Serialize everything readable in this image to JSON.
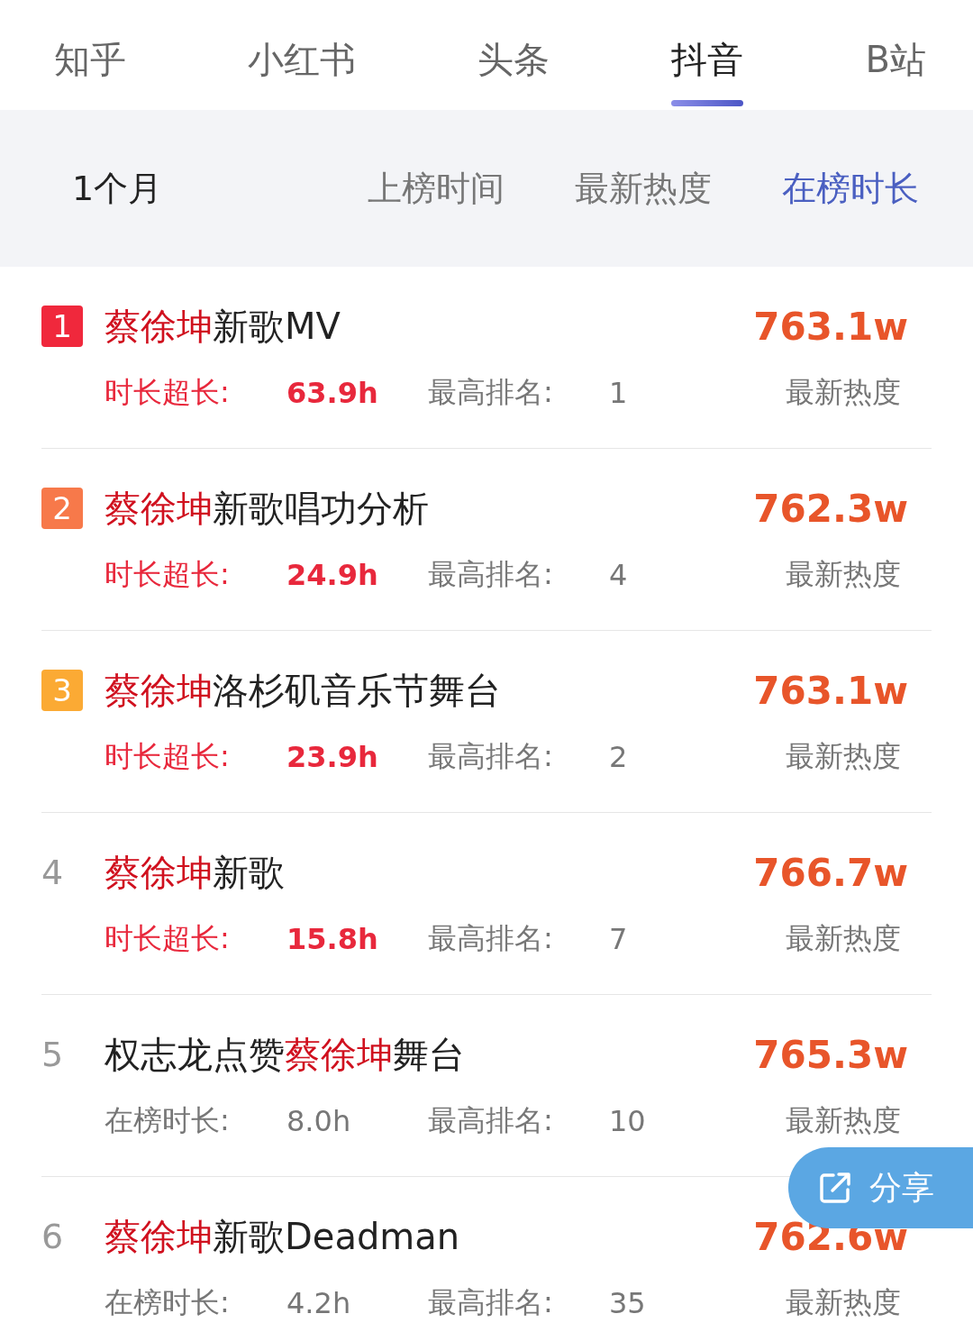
{
  "tabs": [
    {
      "label": "知乎",
      "selected": false
    },
    {
      "label": "小红书",
      "selected": false
    },
    {
      "label": "头条",
      "selected": false
    },
    {
      "label": "抖音",
      "selected": true
    },
    {
      "label": "B站",
      "selected": false
    }
  ],
  "filters": {
    "period": "1个月",
    "sorts": [
      {
        "label": "上榜时间",
        "selected": false
      },
      {
        "label": "最新热度",
        "selected": false
      },
      {
        "label": "在榜时长",
        "selected": true
      }
    ]
  },
  "items": [
    {
      "rank": "1",
      "kind": "badge",
      "color": "#f0283c",
      "title_parts": [
        {
          "text": "蔡徐坤",
          "highlight": true
        },
        {
          "text": "新歌MV",
          "highlight": false
        }
      ],
      "heat": "763.1w",
      "duration_highlighted": true,
      "duration_label": "时长超长:",
      "duration": "63.9h",
      "best_label": "最高排名:",
      "best": "1",
      "heat_label": "最新热度"
    },
    {
      "rank": "2",
      "kind": "badge",
      "color": "#f7794a",
      "title_parts": [
        {
          "text": "蔡徐坤",
          "highlight": true
        },
        {
          "text": "新歌唱功分析",
          "highlight": false
        }
      ],
      "heat": "762.3w",
      "duration_highlighted": true,
      "duration_label": "时长超长:",
      "duration": "24.9h",
      "best_label": "最高排名:",
      "best": "4",
      "heat_label": "最新热度"
    },
    {
      "rank": "3",
      "kind": "badge",
      "color": "#fbaa34",
      "title_parts": [
        {
          "text": "蔡徐坤",
          "highlight": true
        },
        {
          "text": "洛杉矶音乐节舞台",
          "highlight": false
        }
      ],
      "heat": "763.1w",
      "duration_highlighted": true,
      "duration_label": "时长超长:",
      "duration": "23.9h",
      "best_label": "最高排名:",
      "best": "2",
      "heat_label": "最新热度"
    },
    {
      "rank": "4",
      "kind": "plain",
      "title_parts": [
        {
          "text": "蔡徐坤",
          "highlight": true
        },
        {
          "text": "新歌",
          "highlight": false
        }
      ],
      "heat": "766.7w",
      "duration_highlighted": true,
      "duration_label": "时长超长:",
      "duration": "15.8h",
      "best_label": "最高排名:",
      "best": "7",
      "heat_label": "最新热度"
    },
    {
      "rank": "5",
      "kind": "plain",
      "title_parts": [
        {
          "text": "权志龙点赞",
          "highlight": false
        },
        {
          "text": "蔡徐坤",
          "highlight": true
        },
        {
          "text": "舞台",
          "highlight": false
        }
      ],
      "heat": "765.3w",
      "duration_highlighted": false,
      "duration_label": "在榜时长:",
      "duration": "8.0h",
      "best_label": "最高排名:",
      "best": "10",
      "heat_label": "最新热度"
    },
    {
      "rank": "6",
      "kind": "plain",
      "title_parts": [
        {
          "text": "蔡徐坤",
          "highlight": true
        },
        {
          "text": "新歌Deadman",
          "highlight": false
        }
      ],
      "heat": "762.6w",
      "duration_highlighted": false,
      "duration_label": "在榜时长:",
      "duration": "4.2h",
      "best_label": "最高排名:",
      "best": "35",
      "heat_label": "最新热度"
    }
  ],
  "share": {
    "label": "分享"
  }
}
